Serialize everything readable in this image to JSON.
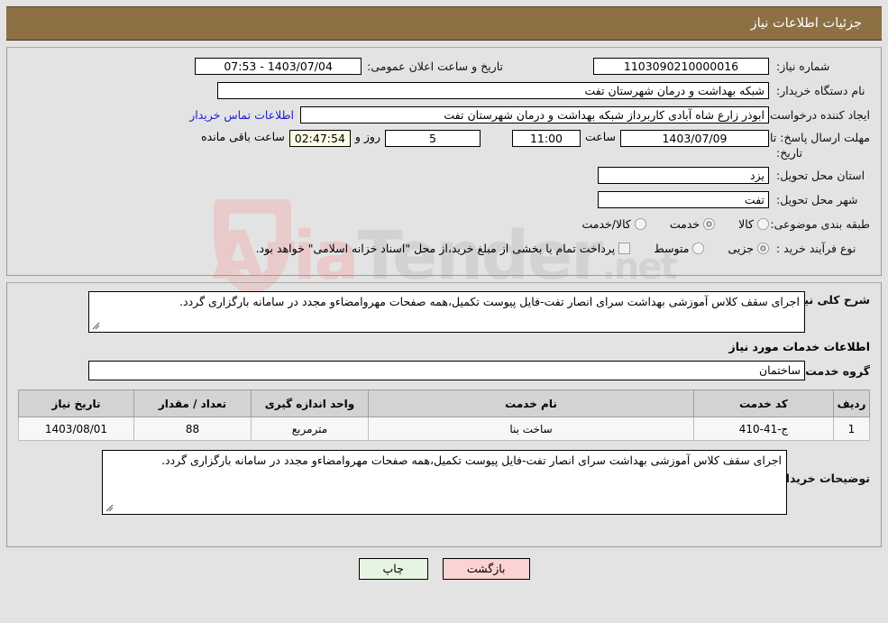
{
  "header": {
    "title": "جزئیات اطلاعات نیاز"
  },
  "top_form": {
    "need_number_label": "شماره نیاز:",
    "need_number_value": "1103090210000016",
    "announce_label": "تاریخ و ساعت اعلان عمومی:",
    "announce_value": "1403/07/04 - 07:53",
    "buyer_org_label": "نام دستگاه خریدار:",
    "buyer_org_value": "شبکه بهداشت و درمان شهرستان تفت",
    "requester_label": "ایجاد کننده درخواست:",
    "requester_value": "ابوذر زارع شاه آبادی کاربرداز شبکه بهداشت و درمان شهرستان تفت",
    "contact_link": "اطلاعات تماس خریدار",
    "deadline_label_line1": "مهلت ارسال پاسخ: تا",
    "deadline_label_line2": "تاریخ:",
    "deadline_date": "1403/07/09",
    "deadline_hour_label": "ساعت",
    "deadline_hour": "11:00",
    "remaining_days": "5",
    "remaining_days_label": "روز و",
    "remaining_time": "02:47:54",
    "remaining_time_label": "ساعت باقی مانده",
    "province_label": "استان محل تحویل:",
    "province_value": "یزد",
    "city_label": "شهر محل تحویل:",
    "city_value": "تفت",
    "category_label": "طبقه بندی موضوعی:",
    "category_options": [
      {
        "label": "کالا",
        "checked": false
      },
      {
        "label": "خدمت",
        "checked": true
      },
      {
        "label": "کالا/خدمت",
        "checked": false
      }
    ],
    "process_label": "نوع فرآیند خرید :",
    "process_options": [
      {
        "label": "جزیی",
        "checked": true
      },
      {
        "label": "متوسط",
        "checked": false
      }
    ],
    "treasury_checkbox_label": "پرداخت تمام یا بخشی از مبلغ خرید،از محل \"اسناد خزانه اسلامی\" خواهد بود.",
    "treasury_checked": false
  },
  "middle": {
    "general_desc_label": "شرح کلی نیاز:",
    "general_desc_value": "اجرای سقف کلاس آموزشی بهداشت سرای انصار تفت-فایل پیوست تکمیل،همه صفحات مهروامضاءو مجدد در سامانه بارگزاری گردد.",
    "services_section_title": "اطلاعات خدمات مورد نیاز",
    "service_group_label": "گروه خدمت:",
    "service_group_value": "ساختمان",
    "table": {
      "columns": [
        "ردیف",
        "کد خدمت",
        "نام خدمت",
        "واحد اندازه گیری",
        "تعداد / مقدار",
        "تاریخ نیاز"
      ],
      "rows": [
        [
          "1",
          "ج-41-410",
          "ساخت بنا",
          "مترمربع",
          "88",
          "1403/08/01"
        ]
      ]
    },
    "buyer_notes_label": "توضیحات خریدار:",
    "buyer_notes_value": "اجرای سقف کلاس آموزشی بهداشت سرای انصار تفت-فایل پیوست تکمیل،همه صفحات مهروامضاءو مجدد در سامانه بارگزاری گردد."
  },
  "buttons": {
    "print": "چاپ",
    "back": "بازگشت"
  },
  "watermark": {
    "text_left": "Aria",
    "text_right": "Tender",
    "suffix": ".net"
  },
  "colors": {
    "titlebar": "#8d7044",
    "page_bg": "#e3e3e3",
    "link": "#1a1ad6",
    "print_btn": "#e6f5e2",
    "back_btn": "#fbd3d3",
    "highlight_field": "#fbfbe6"
  }
}
